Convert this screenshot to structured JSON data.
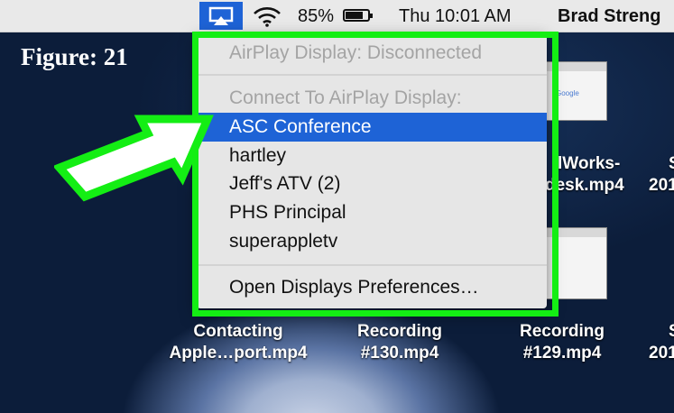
{
  "figure": {
    "label": "Figure: 21"
  },
  "menubar": {
    "airplay_icon": "airplay-icon",
    "wifi_icon": "wifi-icon",
    "battery_percent": "85%",
    "battery_level": 0.85,
    "clock": "Thu 10:01 AM",
    "user": "Brad Streng"
  },
  "airplay_menu": {
    "status": "AirPlay Display: Disconnected",
    "section_header": "Connect To AirPlay Display:",
    "devices": [
      "ASC Conference",
      "hartley",
      "Jeff's ATV (2)",
      "PHS Principal",
      "superappletv"
    ],
    "selected": "ASC Conference",
    "preferences": "Open Displays Preferences…"
  },
  "desktop": {
    "partial_label_1a": "lWorks-",
    "partial_label_1b": "desk.mp4",
    "partial_label_2a": "S",
    "partial_label_2b": "201",
    "thumb_text": "Google",
    "icons": [
      {
        "line1": "Contacting",
        "line2": "Apple…port.mp4"
      },
      {
        "line1": "Recording",
        "line2": "#130.mp4"
      },
      {
        "line1": "Recording",
        "line2": "#129.mp4"
      },
      {
        "line1": "S",
        "line2": "201"
      }
    ]
  },
  "colors": {
    "highlight": "#14ee14",
    "selection": "#1e63d6",
    "menubar": "#e9e9e9"
  }
}
